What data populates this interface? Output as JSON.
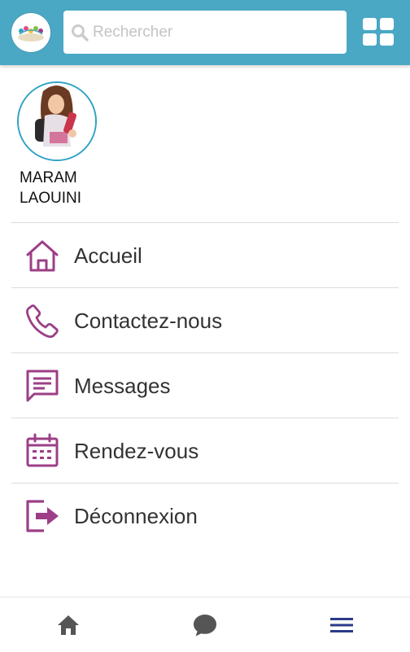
{
  "header": {
    "logo_icon": "app-logo-icon",
    "search": {
      "placeholder": "Rechercher",
      "value": ""
    },
    "apps_button_icon": "grid-icon"
  },
  "profile": {
    "avatar_icon": "user-avatar",
    "name_first": "MARAM",
    "name_last": "LAOUINI"
  },
  "menu": {
    "accent_color": "#9c3f87",
    "items": [
      {
        "label": "Accueil",
        "icon": "home-icon"
      },
      {
        "label": "Contactez-nous",
        "icon": "phone-icon"
      },
      {
        "label": "Messages",
        "icon": "message-icon"
      },
      {
        "label": "Rendez-vous",
        "icon": "calendar-icon"
      },
      {
        "label": "Déconnexion",
        "icon": "logout-icon"
      }
    ]
  },
  "bottom_nav": {
    "items": [
      {
        "icon": "home-icon",
        "color": "#555555"
      },
      {
        "icon": "chat-icon",
        "color": "#555555"
      },
      {
        "icon": "menu-icon",
        "color": "#2b3a8a",
        "active": true
      }
    ]
  },
  "colors": {
    "header": "#4aa8c5",
    "avatar_border": "#2ea2c4"
  }
}
